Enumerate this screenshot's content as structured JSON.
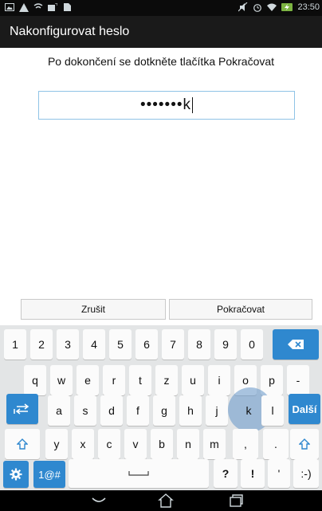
{
  "status_bar": {
    "time": "23:50",
    "left_icons": [
      "gallery-icon",
      "warning-icon",
      "wifi-off-icon",
      "download-icon",
      "image-icon"
    ],
    "right_icons": [
      "mute-icon",
      "alarm-icon",
      "wifi-icon",
      "battery-charging-icon"
    ],
    "battery_color": "#7cb342"
  },
  "header": {
    "title": "Nakonfigurovat heslo"
  },
  "main": {
    "instruction": "Po dokončení se dotkněte tlačítka Pokračovat",
    "password_masked": "•••••••k"
  },
  "actions": {
    "cancel_label": "Zrušit",
    "continue_label": "Pokračovat"
  },
  "keyboard": {
    "row1": [
      "1",
      "2",
      "3",
      "4",
      "5",
      "6",
      "7",
      "8",
      "9",
      "0"
    ],
    "row2": [
      "q",
      "w",
      "e",
      "r",
      "t",
      "z",
      "u",
      "i",
      "o",
      "p",
      "-"
    ],
    "row3": [
      "a",
      "s",
      "d",
      "f",
      "g",
      "h",
      "j",
      "k",
      "l"
    ],
    "row3_next_label": "Další",
    "row4": [
      "y",
      "x",
      "c",
      "v",
      "b",
      "n",
      "m",
      ",",
      "."
    ],
    "row5_symbols_label": "1@#",
    "row5_keys": [
      "?",
      "!",
      "'",
      ":-)"
    ],
    "accent_color": "#2f88cf",
    "pressed_key": "k"
  },
  "navigation": {
    "items": [
      "back-icon",
      "home-icon",
      "recents-icon"
    ]
  }
}
